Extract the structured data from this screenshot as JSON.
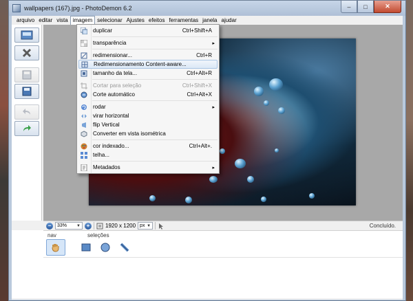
{
  "window": {
    "title_file": "wallpapers (167).jpg",
    "title_sep": " - ",
    "title_app": "PhotoDemon 6.2",
    "minimize": "–",
    "maximize": "□",
    "close": "✕"
  },
  "menubar": [
    "arquivo",
    "editar",
    "vista",
    "imagem",
    "selecionar",
    "Ajustes",
    "efeitos",
    "ferramentas",
    "janela",
    "ajudar"
  ],
  "dropdown": [
    {
      "label": "duplicar",
      "shortcut": "Ctrl+Shift+A",
      "icon": "duplicate-icon"
    },
    {
      "label": "transparência",
      "submenu": "▸",
      "icon": "transparency-icon"
    },
    {
      "label": "redimensionar...",
      "shortcut": "Ctrl+R",
      "icon": "resize-icon"
    },
    {
      "label": "Redimensionamento Content-aware...",
      "icon": "content-aware-resize-icon",
      "highlighted": true
    },
    {
      "label": "tamanho da tela...",
      "shortcut": "Ctrl+Alt+R",
      "icon": "canvas-size-icon"
    },
    {
      "label": "Cortar para seleção",
      "shortcut": "Ctrl+Shift+X",
      "icon": "crop-icon",
      "disabled": true
    },
    {
      "label": "Corte automático",
      "shortcut": "Ctrl+Alt+X",
      "icon": "autocrop-icon"
    },
    {
      "label": "rodar",
      "submenu": "▸",
      "icon": "rotate-icon"
    },
    {
      "label": "virar horizontal",
      "icon": "flip-horizontal-icon"
    },
    {
      "label": "flip Vertical",
      "icon": "flip-vertical-icon"
    },
    {
      "label": "Converter em vista isométrica",
      "icon": "isometric-icon"
    },
    {
      "label": "cor indexado...",
      "shortcut": "Ctrl+Alt+.",
      "icon": "indexed-color-icon"
    },
    {
      "label": "telha...",
      "icon": "tile-icon"
    },
    {
      "label": "Metadados",
      "submenu": "▸",
      "icon": "metadata-icon"
    }
  ],
  "statusbar": {
    "zoom_out": "−",
    "zoom_value": "33%",
    "zoom_in": "+",
    "dimensions": "1920 x 1200",
    "unit": "px",
    "status": "Concluído."
  },
  "panel": {
    "nav_label": "nav",
    "selections_label": "seleções"
  },
  "colors": {
    "menu_highlight": "#dce8f6",
    "canvas_bg": "#a8a8a8",
    "window_frame": "#b9c9dc"
  }
}
